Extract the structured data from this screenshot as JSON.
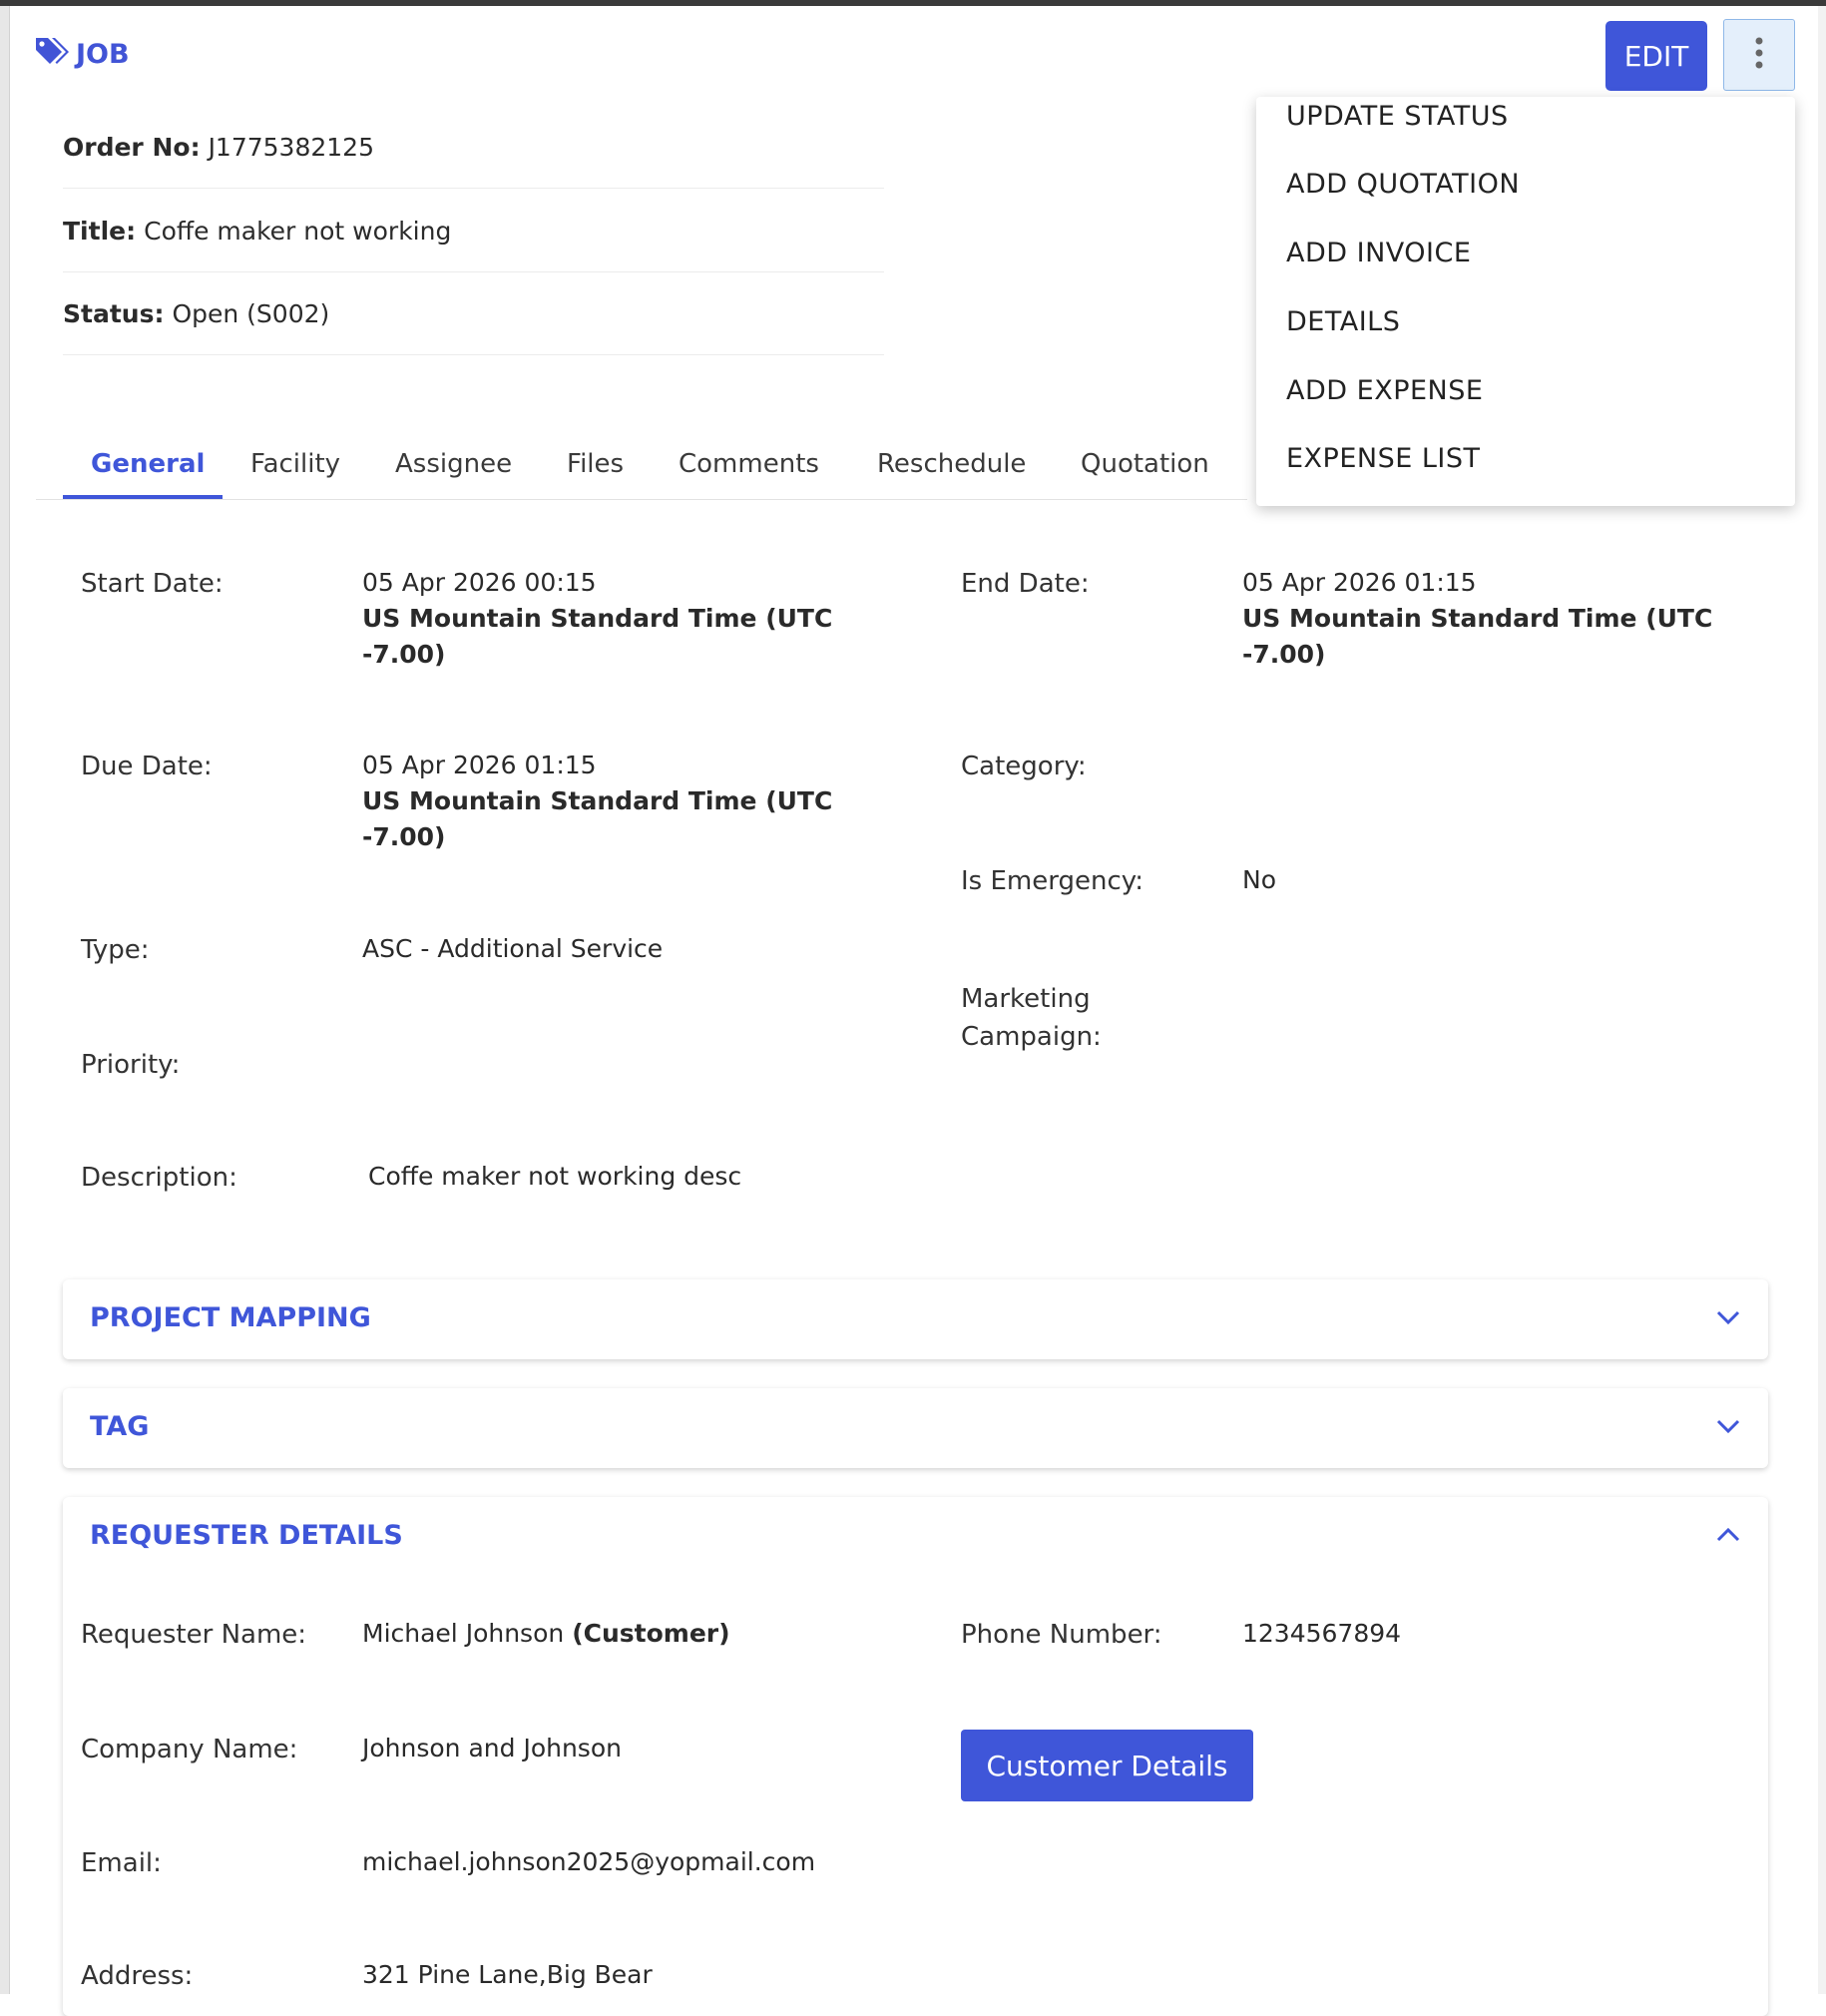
{
  "header": {
    "title": "JOB",
    "edit_label": "EDIT"
  },
  "info": {
    "order_label": "Order No:",
    "order_value": "J1775382125",
    "title_label": "Title:",
    "title_value": "Coffe maker not working",
    "status_label": "Status:",
    "status_value": "Open (S002)"
  },
  "tabs": [
    "General",
    "Facility",
    "Assignee",
    "Files",
    "Comments",
    "Reschedule",
    "Quotation"
  ],
  "menu": [
    "UPDATE STATUS",
    "ADD QUOTATION",
    "ADD INVOICE",
    "DETAILS",
    "ADD EXPENSE",
    "EXPENSE LIST"
  ],
  "general": {
    "start_label": "Start Date:",
    "start_date": "05 Apr 2026 00:15",
    "end_label": "End Date:",
    "end_date": "05 Apr 2026 01:15",
    "due_label": "Due Date:",
    "due_date": "05 Apr 2026 01:15",
    "tz_line1": "US Mountain Standard Time (UTC",
    "tz_line2": "-7.00)",
    "category_label": "Category:",
    "emergency_label": "Is Emergency:",
    "emergency_value": "No",
    "type_label": "Type:",
    "type_value": "ASC - Additional Service",
    "marketing_label_1": "Marketing",
    "marketing_label_2": "Campaign:",
    "priority_label": "Priority:",
    "description_label": "Description:",
    "description_value": "Coffe maker not working desc"
  },
  "panels": {
    "project_mapping": "PROJECT MAPPING",
    "tag": "TAG",
    "requester": "REQUESTER DETAILS"
  },
  "requester": {
    "name_label": "Requester Name:",
    "name_value": "Michael Johnson",
    "name_role": "(Customer)",
    "phone_label": "Phone Number:",
    "phone_value": "1234567894",
    "company_label": "Company Name:",
    "company_value": "Johnson and Johnson",
    "customer_button": "Customer Details",
    "email_label": "Email:",
    "email_value": "michael.johnson2025@yopmail.com",
    "address_label": "Address:",
    "address_value": "321 Pine Lane,Big Bear"
  },
  "colors": {
    "accent": "#3f56d9",
    "kebab_bg": "#e4effb"
  }
}
